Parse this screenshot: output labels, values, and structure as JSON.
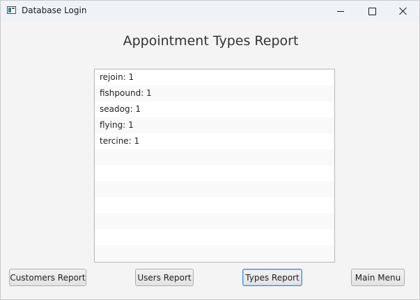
{
  "window": {
    "title": "Database Login",
    "controls": [
      "minimize",
      "maximize",
      "close"
    ]
  },
  "page": {
    "title": "Appointment Types Report"
  },
  "report": {
    "items": [
      "rejoin: 1",
      "fishpound: 1",
      "seadog: 1",
      "flying: 1",
      "tercine: 1",
      "",
      "",
      "",
      "",
      "",
      "",
      ""
    ]
  },
  "buttons": {
    "customers": "Customers Report",
    "users": "Users Report",
    "types": "Types Report",
    "main_menu": "Main Menu"
  },
  "colors": {
    "focus_border": "#3b8fd6",
    "list_alt_row": "#f9f9f9"
  },
  "icons": {
    "app": "app-window-icon",
    "minimize": "minimize-icon",
    "maximize": "maximize-icon",
    "close": "close-icon"
  }
}
